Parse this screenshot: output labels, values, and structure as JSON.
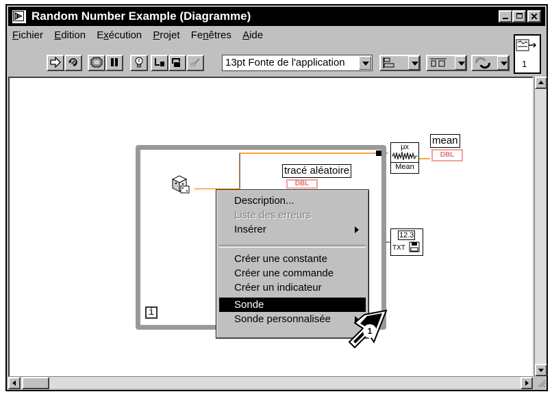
{
  "window": {
    "title": "Random Number Example (Diagramme)"
  },
  "menubar": {
    "items": [
      {
        "label_u": "F",
        "label_rest": "ichier"
      },
      {
        "label_u": "E",
        "label_rest": "dition"
      },
      {
        "label_pre": "E",
        "label_u": "x",
        "label_rest": "écution"
      },
      {
        "label_u": "P",
        "label_rest": "rojet"
      },
      {
        "label_pre": "Fe",
        "label_u": "n",
        "label_rest": "êtres"
      },
      {
        "label_u": "A",
        "label_rest": "ide"
      }
    ]
  },
  "toolbar": {
    "font_select": "13pt Fonte de l'application",
    "context_help_number": "1"
  },
  "diagram": {
    "random_label": "tracé aléatoire",
    "random_type": "DBL",
    "mean_label": "mean",
    "mean_type": "DBL",
    "mean_node_symbol": "μx",
    "mean_node_label": "Mean",
    "write_node_value": "12.3",
    "write_node_label": "TXT",
    "loop_iteration": "i",
    "callout_number": "1"
  },
  "context_menu": {
    "items": [
      {
        "label": "Description...",
        "state": "normal"
      },
      {
        "label": "Liste des erreurs",
        "state": "disabled"
      },
      {
        "label": "Insérer",
        "state": "submenu"
      },
      {
        "label": "Créer une constante",
        "state": "normal"
      },
      {
        "label": "Créer une commande",
        "state": "normal"
      },
      {
        "label": "Créer un indicateur",
        "state": "normal"
      },
      {
        "label": "Sonde",
        "state": "selected"
      },
      {
        "label": "Sonde personnalisée",
        "state": "submenu"
      }
    ]
  }
}
